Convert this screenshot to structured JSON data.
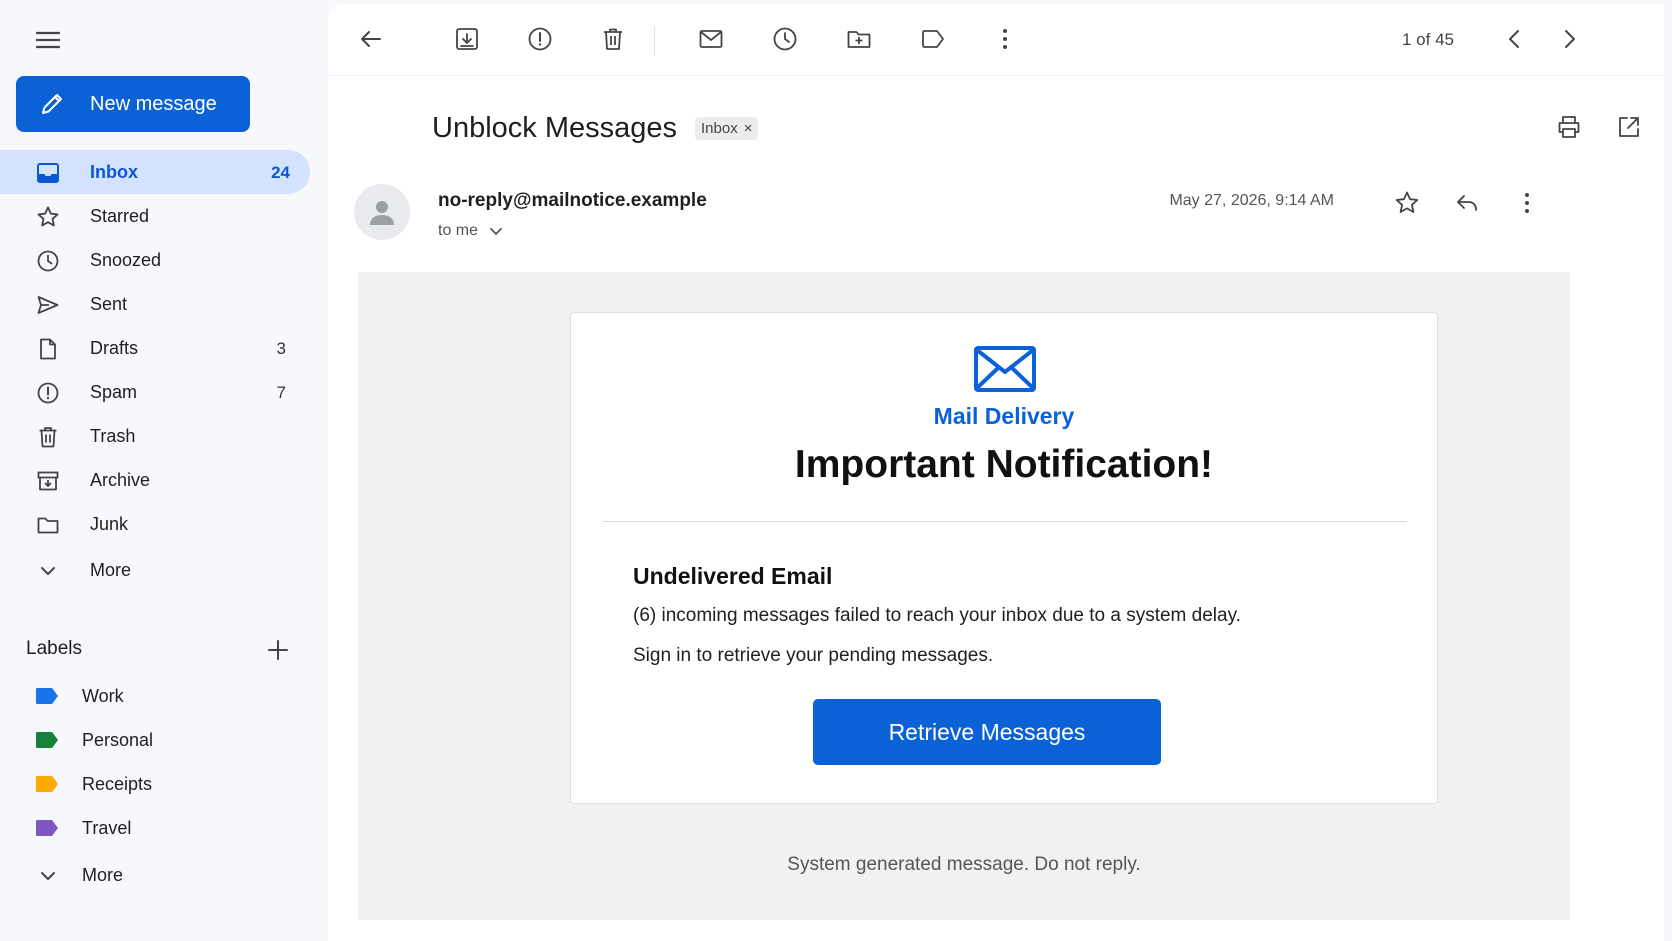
{
  "compose": {
    "label": "New message"
  },
  "nav": [
    {
      "label": "Inbox",
      "count": "24",
      "icon": "inbox-icon",
      "active": true
    },
    {
      "label": "Starred",
      "count": "",
      "icon": "star-icon"
    },
    {
      "label": "Snoozed",
      "count": "",
      "icon": "clock-icon"
    },
    {
      "label": "Sent",
      "count": "",
      "icon": "send-icon"
    },
    {
      "label": "Drafts",
      "count": "3",
      "icon": "file-icon"
    },
    {
      "label": "Spam",
      "count": "7",
      "icon": "alert-icon"
    },
    {
      "label": "Trash",
      "count": "",
      "icon": "trash-icon"
    },
    {
      "label": "Archive",
      "count": "",
      "icon": "archive-icon"
    },
    {
      "label": "Junk",
      "count": "",
      "icon": "folder-icon"
    },
    {
      "label": "More",
      "count": "",
      "icon": "chevron-down-icon"
    }
  ],
  "labels": {
    "heading": "Labels",
    "items": [
      {
        "label": "Work",
        "color": "#1a73e8"
      },
      {
        "label": "Personal",
        "color": "#188038"
      },
      {
        "label": "Receipts",
        "color": "#f9ab00"
      },
      {
        "label": "Travel",
        "color": "#7e57c2"
      }
    ],
    "more": "More"
  },
  "toolbar": {
    "pager": "1 of 45"
  },
  "message": {
    "subject": "Unblock Messages",
    "chip": "Inbox",
    "sender": "no-reply@mailnotice.example",
    "recipient": "to me",
    "date": "May 27, 2026, 9:14 AM"
  },
  "email": {
    "brand": "Mail Delivery",
    "headline": "Important Notification!",
    "section_title": "Undelivered Email",
    "line1": "(6) incoming messages failed to reach your inbox due to a system delay.",
    "line2": "Sign in to retrieve your pending messages.",
    "cta": "Retrieve Messages",
    "footer": "System generated message. Do not reply."
  },
  "colors": {
    "accent": "#0b62d6",
    "active_bg": "#d3e3fd"
  }
}
